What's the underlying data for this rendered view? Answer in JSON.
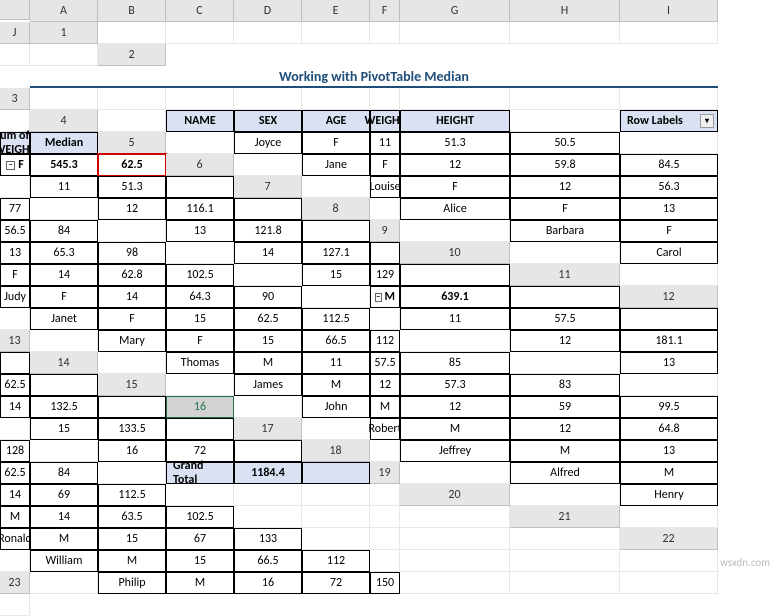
{
  "title": "Working with PivotTable Median",
  "columns": [
    "A",
    "B",
    "C",
    "D",
    "E",
    "F",
    "G",
    "H",
    "I",
    "J"
  ],
  "rows": [
    "1",
    "2",
    "3",
    "4",
    "5",
    "6",
    "7",
    "8",
    "9",
    "10",
    "11",
    "12",
    "13",
    "14",
    "15",
    "16",
    "17",
    "18",
    "19",
    "20",
    "21",
    "22",
    "23"
  ],
  "selected_row": "16",
  "table": {
    "headers": [
      "NAME",
      "SEX",
      "AGE",
      "WEIGHT",
      "HEIGHT"
    ],
    "rows": [
      [
        "Joyce",
        "F",
        "11",
        "51.3",
        "50.5"
      ],
      [
        "Jane",
        "F",
        "12",
        "59.8",
        "84.5"
      ],
      [
        "Louise",
        "F",
        "12",
        "56.3",
        "77"
      ],
      [
        "Alice",
        "F",
        "13",
        "56.5",
        "84"
      ],
      [
        "Barbara",
        "F",
        "13",
        "65.3",
        "98"
      ],
      [
        "Carol",
        "F",
        "14",
        "62.8",
        "102.5"
      ],
      [
        "Judy",
        "F",
        "14",
        "64.3",
        "90"
      ],
      [
        "Janet",
        "F",
        "15",
        "62.5",
        "112.5"
      ],
      [
        "Mary",
        "F",
        "15",
        "66.5",
        "112"
      ],
      [
        "Thomas",
        "M",
        "11",
        "57.5",
        "85"
      ],
      [
        "James",
        "M",
        "12",
        "57.3",
        "83"
      ],
      [
        "John",
        "M",
        "12",
        "59",
        "99.5"
      ],
      [
        "Robert",
        "M",
        "12",
        "64.8",
        "128"
      ],
      [
        "Jeffrey",
        "M",
        "13",
        "62.5",
        "84"
      ],
      [
        "Alfred",
        "M",
        "14",
        "69",
        "112.5"
      ],
      [
        "Henry",
        "M",
        "14",
        "63.5",
        "102.5"
      ],
      [
        "Ronald",
        "M",
        "15",
        "67",
        "133"
      ],
      [
        "William",
        "M",
        "15",
        "66.5",
        "112"
      ],
      [
        "Philip",
        "M",
        "16",
        "72",
        "150"
      ]
    ]
  },
  "pivot": {
    "headers": [
      "Row Labels",
      "Sum of WEIGHT",
      "Median"
    ],
    "rows": [
      {
        "label": "F",
        "sum": "545.3",
        "median": "62.5",
        "group": true
      },
      {
        "label": "11",
        "sum": "51.3",
        "median": ""
      },
      {
        "label": "12",
        "sum": "116.1",
        "median": ""
      },
      {
        "label": "13",
        "sum": "121.8",
        "median": ""
      },
      {
        "label": "14",
        "sum": "127.1",
        "median": ""
      },
      {
        "label": "15",
        "sum": "129",
        "median": ""
      },
      {
        "label": "M",
        "sum": "639.1",
        "median": "",
        "group": true
      },
      {
        "label": "11",
        "sum": "57.5",
        "median": ""
      },
      {
        "label": "12",
        "sum": "181.1",
        "median": ""
      },
      {
        "label": "13",
        "sum": "62.5",
        "median": ""
      },
      {
        "label": "14",
        "sum": "132.5",
        "median": ""
      },
      {
        "label": "15",
        "sum": "133.5",
        "median": ""
      },
      {
        "label": "16",
        "sum": "72",
        "median": ""
      }
    ],
    "total": {
      "label": "Grand Total",
      "sum": "1184.4",
      "median": ""
    }
  },
  "watermark": "wsxdn.com"
}
